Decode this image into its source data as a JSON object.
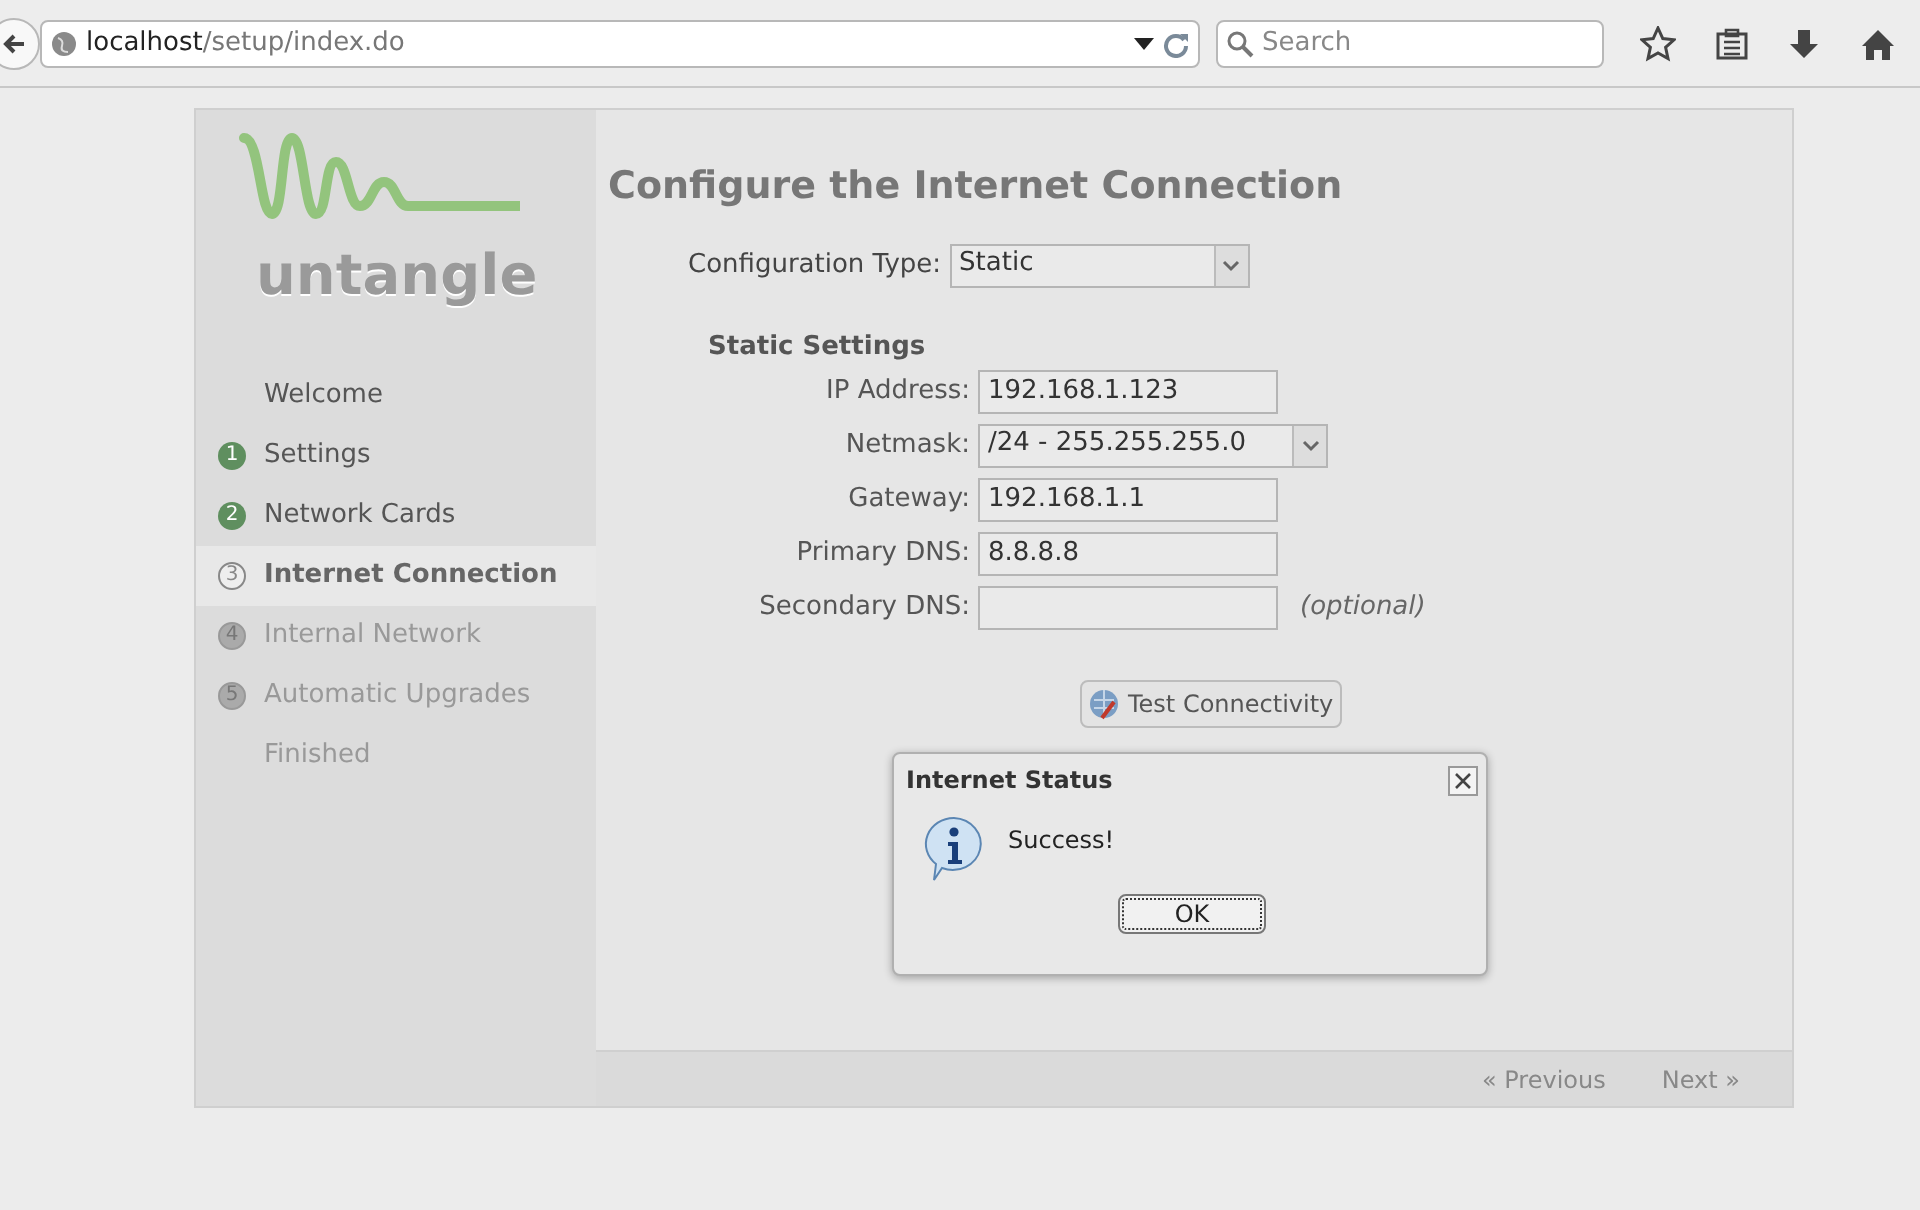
{
  "browser": {
    "url_host": "localhost",
    "url_path": "/setup/index.do",
    "search_placeholder": "Search"
  },
  "logo": {
    "wordmark": "untangle"
  },
  "steps": [
    {
      "label": "Welcome",
      "kind": "plain",
      "selected": false
    },
    {
      "number": "1",
      "label": "Settings",
      "kind": "done",
      "selected": false
    },
    {
      "number": "2",
      "label": "Network Cards",
      "kind": "done",
      "selected": false
    },
    {
      "number": "3",
      "label": "Internet Connection",
      "kind": "current",
      "selected": true
    },
    {
      "number": "4",
      "label": "Internal Network",
      "kind": "pending",
      "selected": false
    },
    {
      "number": "5",
      "label": "Automatic Upgrades",
      "kind": "pending",
      "selected": false
    },
    {
      "label": "Finished",
      "kind": "pending",
      "selected": false
    }
  ],
  "title": "Configure the Internet Connection",
  "config_type": {
    "label": "Configuration Type:",
    "value": "Static"
  },
  "section_title": "Static Settings",
  "fields": [
    {
      "label": "IP Address:",
      "value": "192.168.1.123",
      "kind": "text"
    },
    {
      "label": "Netmask:",
      "value": "/24 - 255.255.255.0",
      "kind": "select"
    },
    {
      "label": "Gateway:",
      "value": "192.168.1.1",
      "kind": "text"
    },
    {
      "label": "Primary DNS:",
      "value": "8.8.8.8",
      "kind": "text"
    },
    {
      "label": "Secondary DNS:",
      "kind": "text",
      "note": "(optional)"
    }
  ],
  "test_button": "Test Connectivity",
  "dialog": {
    "title": "Internet Status",
    "message": "Success!",
    "ok": "OK"
  },
  "footer": {
    "previous": "« Previous",
    "next": "Next »"
  }
}
